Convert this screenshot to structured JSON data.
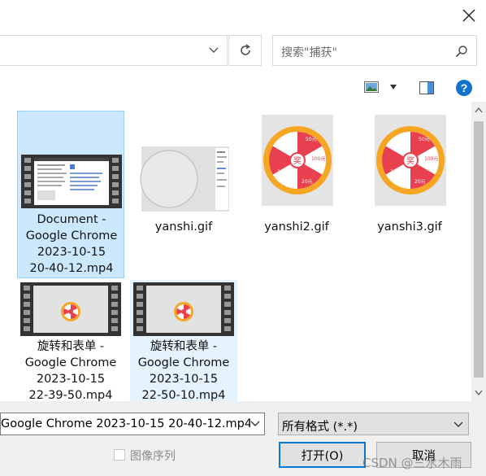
{
  "search": {
    "placeholder": "搜索\"捕获\""
  },
  "files": [
    {
      "name_lines": [
        "Document -",
        "Google Chrome",
        "2023-10-15",
        "20-40-12.mp4"
      ],
      "type": "video",
      "state": "selected"
    },
    {
      "name_lines": [
        "yanshi.gif"
      ],
      "type": "gif-blank",
      "state": "normal"
    },
    {
      "name_lines": [
        "yanshi2.gif"
      ],
      "type": "gif-wheel",
      "state": "normal"
    },
    {
      "name_lines": [
        "yanshi3.gif"
      ],
      "type": "gif-wheel",
      "state": "normal"
    },
    {
      "name_lines": [
        "旋转和表单 -",
        "Google Chrome",
        "2023-10-15",
        "22-39-50.mp4"
      ],
      "type": "video-wheel",
      "state": "normal"
    },
    {
      "name_lines": [
        "旋转和表单 -",
        "Google Chrome",
        "2023-10-15",
        "22-50-10.mp4"
      ],
      "type": "video-wheel",
      "state": "hover"
    }
  ],
  "wheel_labels": [
    "奖",
    "50元",
    "100元",
    "20元",
    "20元"
  ],
  "filename": {
    "value": "Google Chrome 2023-10-15 20-40-12.mp4"
  },
  "filetype": {
    "value": "所有格式 (*.*)"
  },
  "image_sequence": {
    "label": "图像序列",
    "checked": false
  },
  "buttons": {
    "open": "打开(O)",
    "cancel": "取消"
  },
  "help": {
    "glyph": "?"
  },
  "watermark": "CSDN @三水木雨",
  "colors": {
    "accent": "#0078d7",
    "selection": "#cce8ff",
    "help": "#1573d0",
    "wheel_red": "#e8404f",
    "wheel_orange": "#f5a623"
  }
}
